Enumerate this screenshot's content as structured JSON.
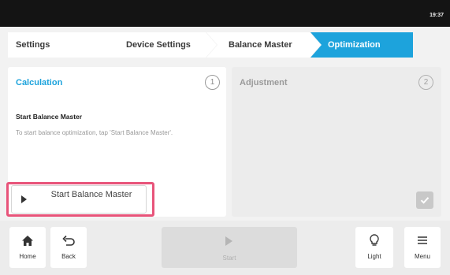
{
  "status_bar": {
    "time": "19:37"
  },
  "breadcrumb": [
    {
      "label": "Settings"
    },
    {
      "label": "Device Settings"
    },
    {
      "label": "Balance Master"
    },
    {
      "label": "Optimization",
      "active": true
    }
  ],
  "calculation_panel": {
    "title": "Calculation",
    "step": "1",
    "subheading": "Start Balance Master",
    "description": "To start balance optimization, tap 'Start Balance Master'.",
    "button_label": "Start Balance Master"
  },
  "adjustment_panel": {
    "title": "Adjustment",
    "step": "2"
  },
  "bottom_bar": {
    "home_label": "Home",
    "back_label": "Back",
    "start_label": "Start",
    "light_label": "Light",
    "menu_label": "Menu"
  },
  "colors": {
    "accent": "#1da3dc",
    "highlight": "#e8547a",
    "status_bar": "#141414"
  }
}
